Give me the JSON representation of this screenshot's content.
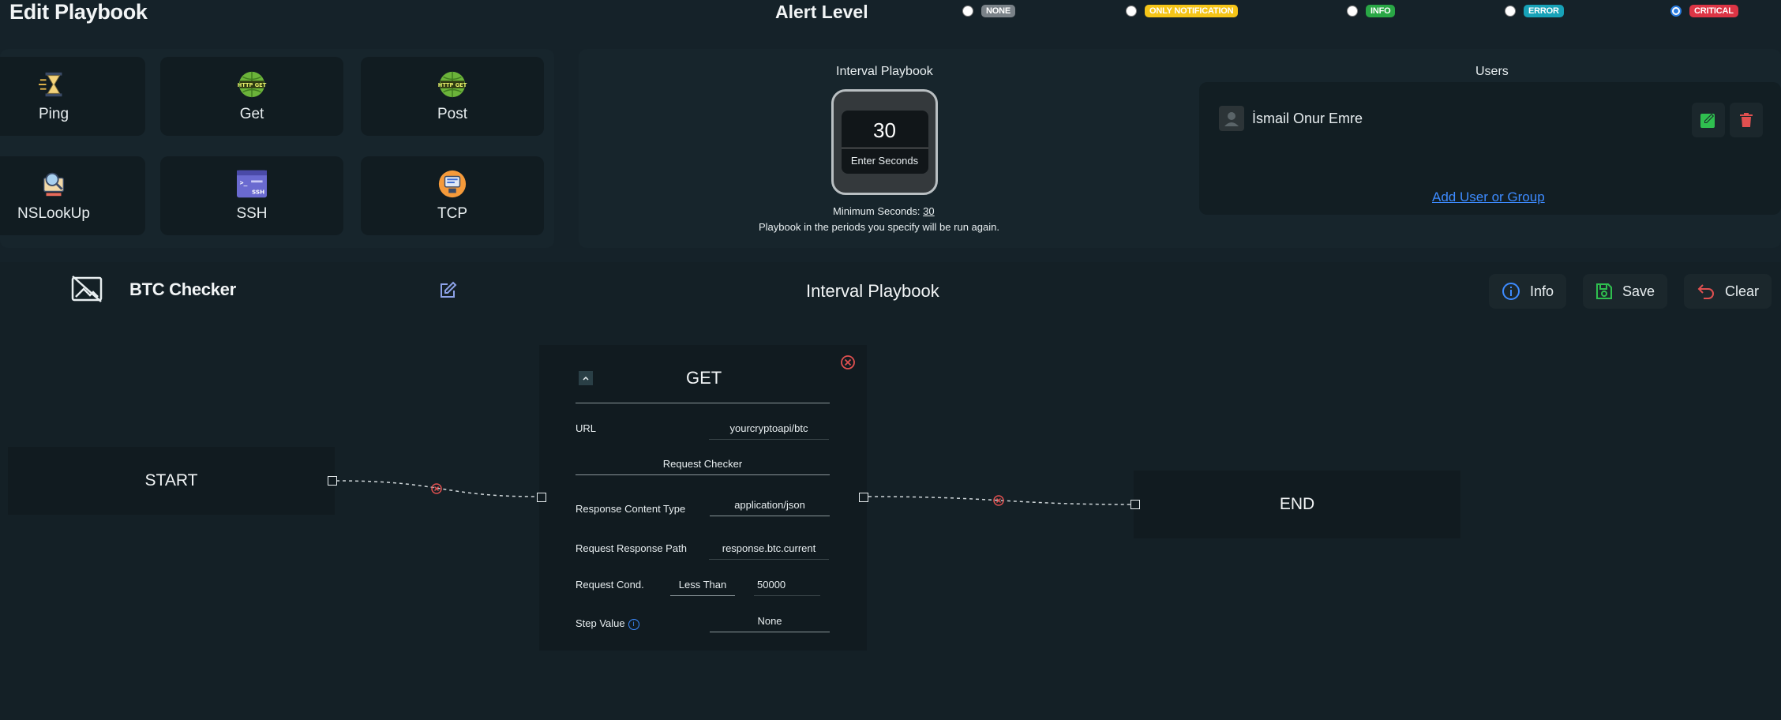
{
  "header": {
    "title": "Edit Playbook",
    "alert_level_title": "Alert Level",
    "alert_levels": [
      {
        "label": "NONE",
        "color": "#7a8288",
        "text_color": "#ffffff",
        "checked": false
      },
      {
        "label": "ONLY NOTIFICATION",
        "color": "#f5c518",
        "text_color": "#ffffff",
        "checked": false
      },
      {
        "label": "INFO",
        "color": "#29a745",
        "text_color": "#ffffff",
        "checked": false
      },
      {
        "label": "ERROR",
        "color": "#17a2b8",
        "text_color": "#ffffff",
        "checked": false
      },
      {
        "label": "CRITICAL",
        "color": "#dc3545",
        "text_color": "#ffffff",
        "checked": true
      }
    ]
  },
  "plugins": [
    {
      "label": "Ping",
      "icon": "hourglass-icon"
    },
    {
      "label": "Get",
      "icon": "http-get-icon"
    },
    {
      "label": "Post",
      "icon": "http-post-icon"
    },
    {
      "label": "NSLookUp",
      "icon": "nslookup-icon"
    },
    {
      "label": "SSH",
      "icon": "terminal-icon"
    },
    {
      "label": "TCP",
      "icon": "tcp-icon"
    }
  ],
  "interval": {
    "title": "Interval Playbook",
    "seconds_value": "30",
    "seconds_hint": "Enter Seconds",
    "min_label": "Minimum Seconds:",
    "min_value": "30",
    "note": "Playbook in the periods you specify will be run again."
  },
  "users": {
    "title": "Users",
    "list": [
      {
        "name": "İsmail Onur Emre"
      }
    ],
    "add_link": "Add User or Group"
  },
  "toolbar": {
    "flow_name": "BTC Checker",
    "flow_type": "Interval Playbook",
    "info_label": "Info",
    "save_label": "Save",
    "clear_label": "Clear"
  },
  "canvas": {
    "start_label": "START",
    "end_label": "END",
    "get_node": {
      "title": "GET",
      "url_label": "URL",
      "url_value": "yourcryptoapi/btc",
      "request_checker": "Request Checker",
      "content_type_label": "Response Content Type",
      "content_type_value": "application/json",
      "response_path_label": "Request Response Path",
      "response_path_value": "response.btc.current",
      "cond_label": "Request Cond.",
      "cond_value": "Less Than",
      "cond_number": "50000",
      "step_label": "Step Value",
      "step_value": "None"
    }
  }
}
